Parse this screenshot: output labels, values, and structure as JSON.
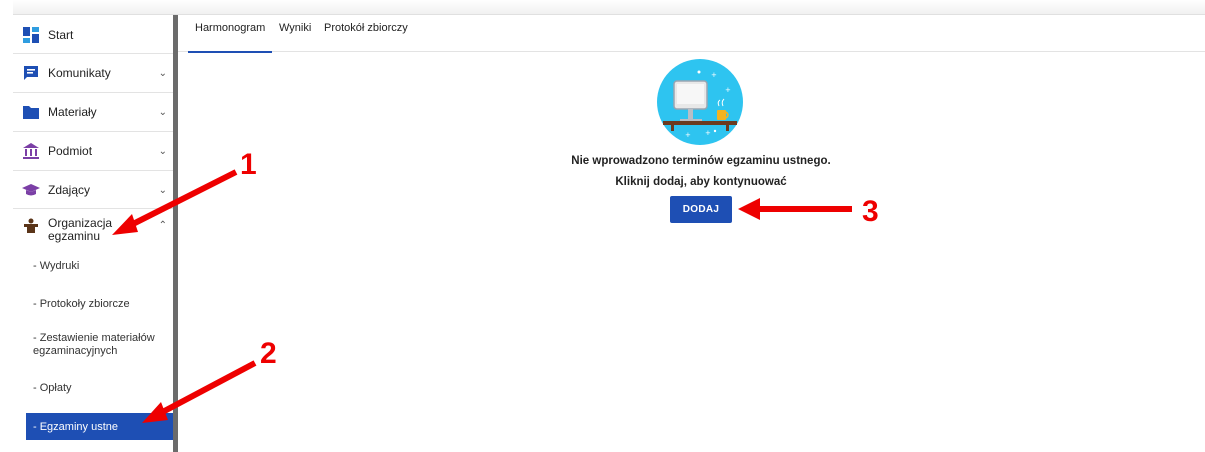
{
  "sidebar": {
    "items": [
      {
        "label": "Start",
        "icon": "dashboard-icon"
      },
      {
        "label": "Komunikaty",
        "icon": "message-icon"
      },
      {
        "label": "Materiały",
        "icon": "folder-icon"
      },
      {
        "label": "Podmiot",
        "icon": "institution-icon"
      },
      {
        "label": "Zdający",
        "icon": "graduation-cap-icon"
      },
      {
        "label": "Organizacja egzaminu",
        "icon": "person-desk-icon"
      }
    ],
    "subitems": [
      {
        "label": "- Wydruki"
      },
      {
        "label": "- Protokoły zbiorcze"
      },
      {
        "label": "- Zestawienie materiałów egzaminacyjnych"
      },
      {
        "label": "- Opłaty"
      },
      {
        "label": "- Egzaminy ustne",
        "active": true
      }
    ]
  },
  "tabs": [
    {
      "label": "Harmonogram",
      "active": true
    },
    {
      "label": "Wyniki"
    },
    {
      "label": "Protokół zbiorczy"
    }
  ],
  "main": {
    "empty_message": "Nie wprowadzono terminów egzaminu ustnego.",
    "hint": "Kliknij dodaj, aby kontynuować",
    "add_button": "DODAJ"
  },
  "annotations": {
    "n1": "1",
    "n2": "2",
    "n3": "3"
  },
  "colors": {
    "primary": "#1e4fb4",
    "annotation": "#ee0000",
    "illustration_bg": "#2ec4f0"
  }
}
